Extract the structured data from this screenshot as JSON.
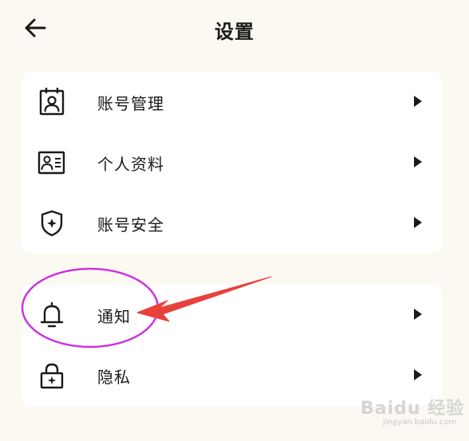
{
  "header": {
    "back_icon": "arrow-left-icon",
    "title": "设置"
  },
  "groups": [
    {
      "items": [
        {
          "label": "账号管理",
          "icon": "account-badge-icon"
        },
        {
          "label": "个人资料",
          "icon": "id-card-icon"
        },
        {
          "label": "账号安全",
          "icon": "shield-icon"
        }
      ]
    },
    {
      "items": [
        {
          "label": "通知",
          "icon": "bell-icon"
        },
        {
          "label": "隐私",
          "icon": "lock-icon"
        }
      ]
    }
  ],
  "row_arrow_icon": "triangle-right-icon",
  "annotation": {
    "highlight_color": "#cc33dd",
    "arrow_color": "#e8413c"
  },
  "watermark": {
    "text": "Baidu 经验",
    "subtext": "jingyan.baidu.com"
  },
  "colors": {
    "background": "#fcf9f2",
    "card": "#ffffff",
    "text": "#1a1a1a"
  }
}
